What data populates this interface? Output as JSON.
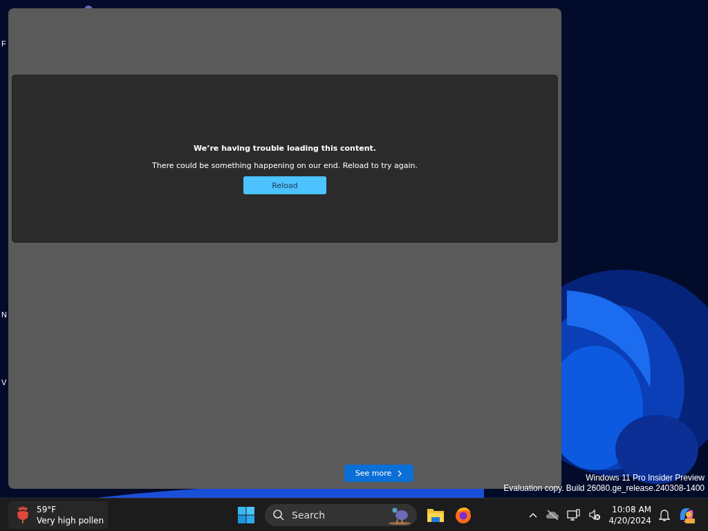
{
  "desktop": {
    "icon_labels": [
      {
        "text": "F"
      },
      {
        "text": "N"
      },
      {
        "text": "V"
      }
    ]
  },
  "panel": {
    "error": {
      "title": "We’re having trouble loading this content.",
      "message": "There could be something happening on our end. Reload to try again.",
      "button": "Reload"
    },
    "see_more": "See more"
  },
  "watermark": {
    "line_1": "Windows 11 Pro Insider Preview",
    "line_2": "Evaluation copy. Build 26080.ge_release.240308-1400"
  },
  "taskbar": {
    "weather": {
      "temperature": "59°F",
      "condition": "Very high pollen"
    },
    "search": {
      "placeholder": "Search"
    },
    "clock": {
      "time": "10:08 AM",
      "date": "4/20/2024"
    }
  }
}
